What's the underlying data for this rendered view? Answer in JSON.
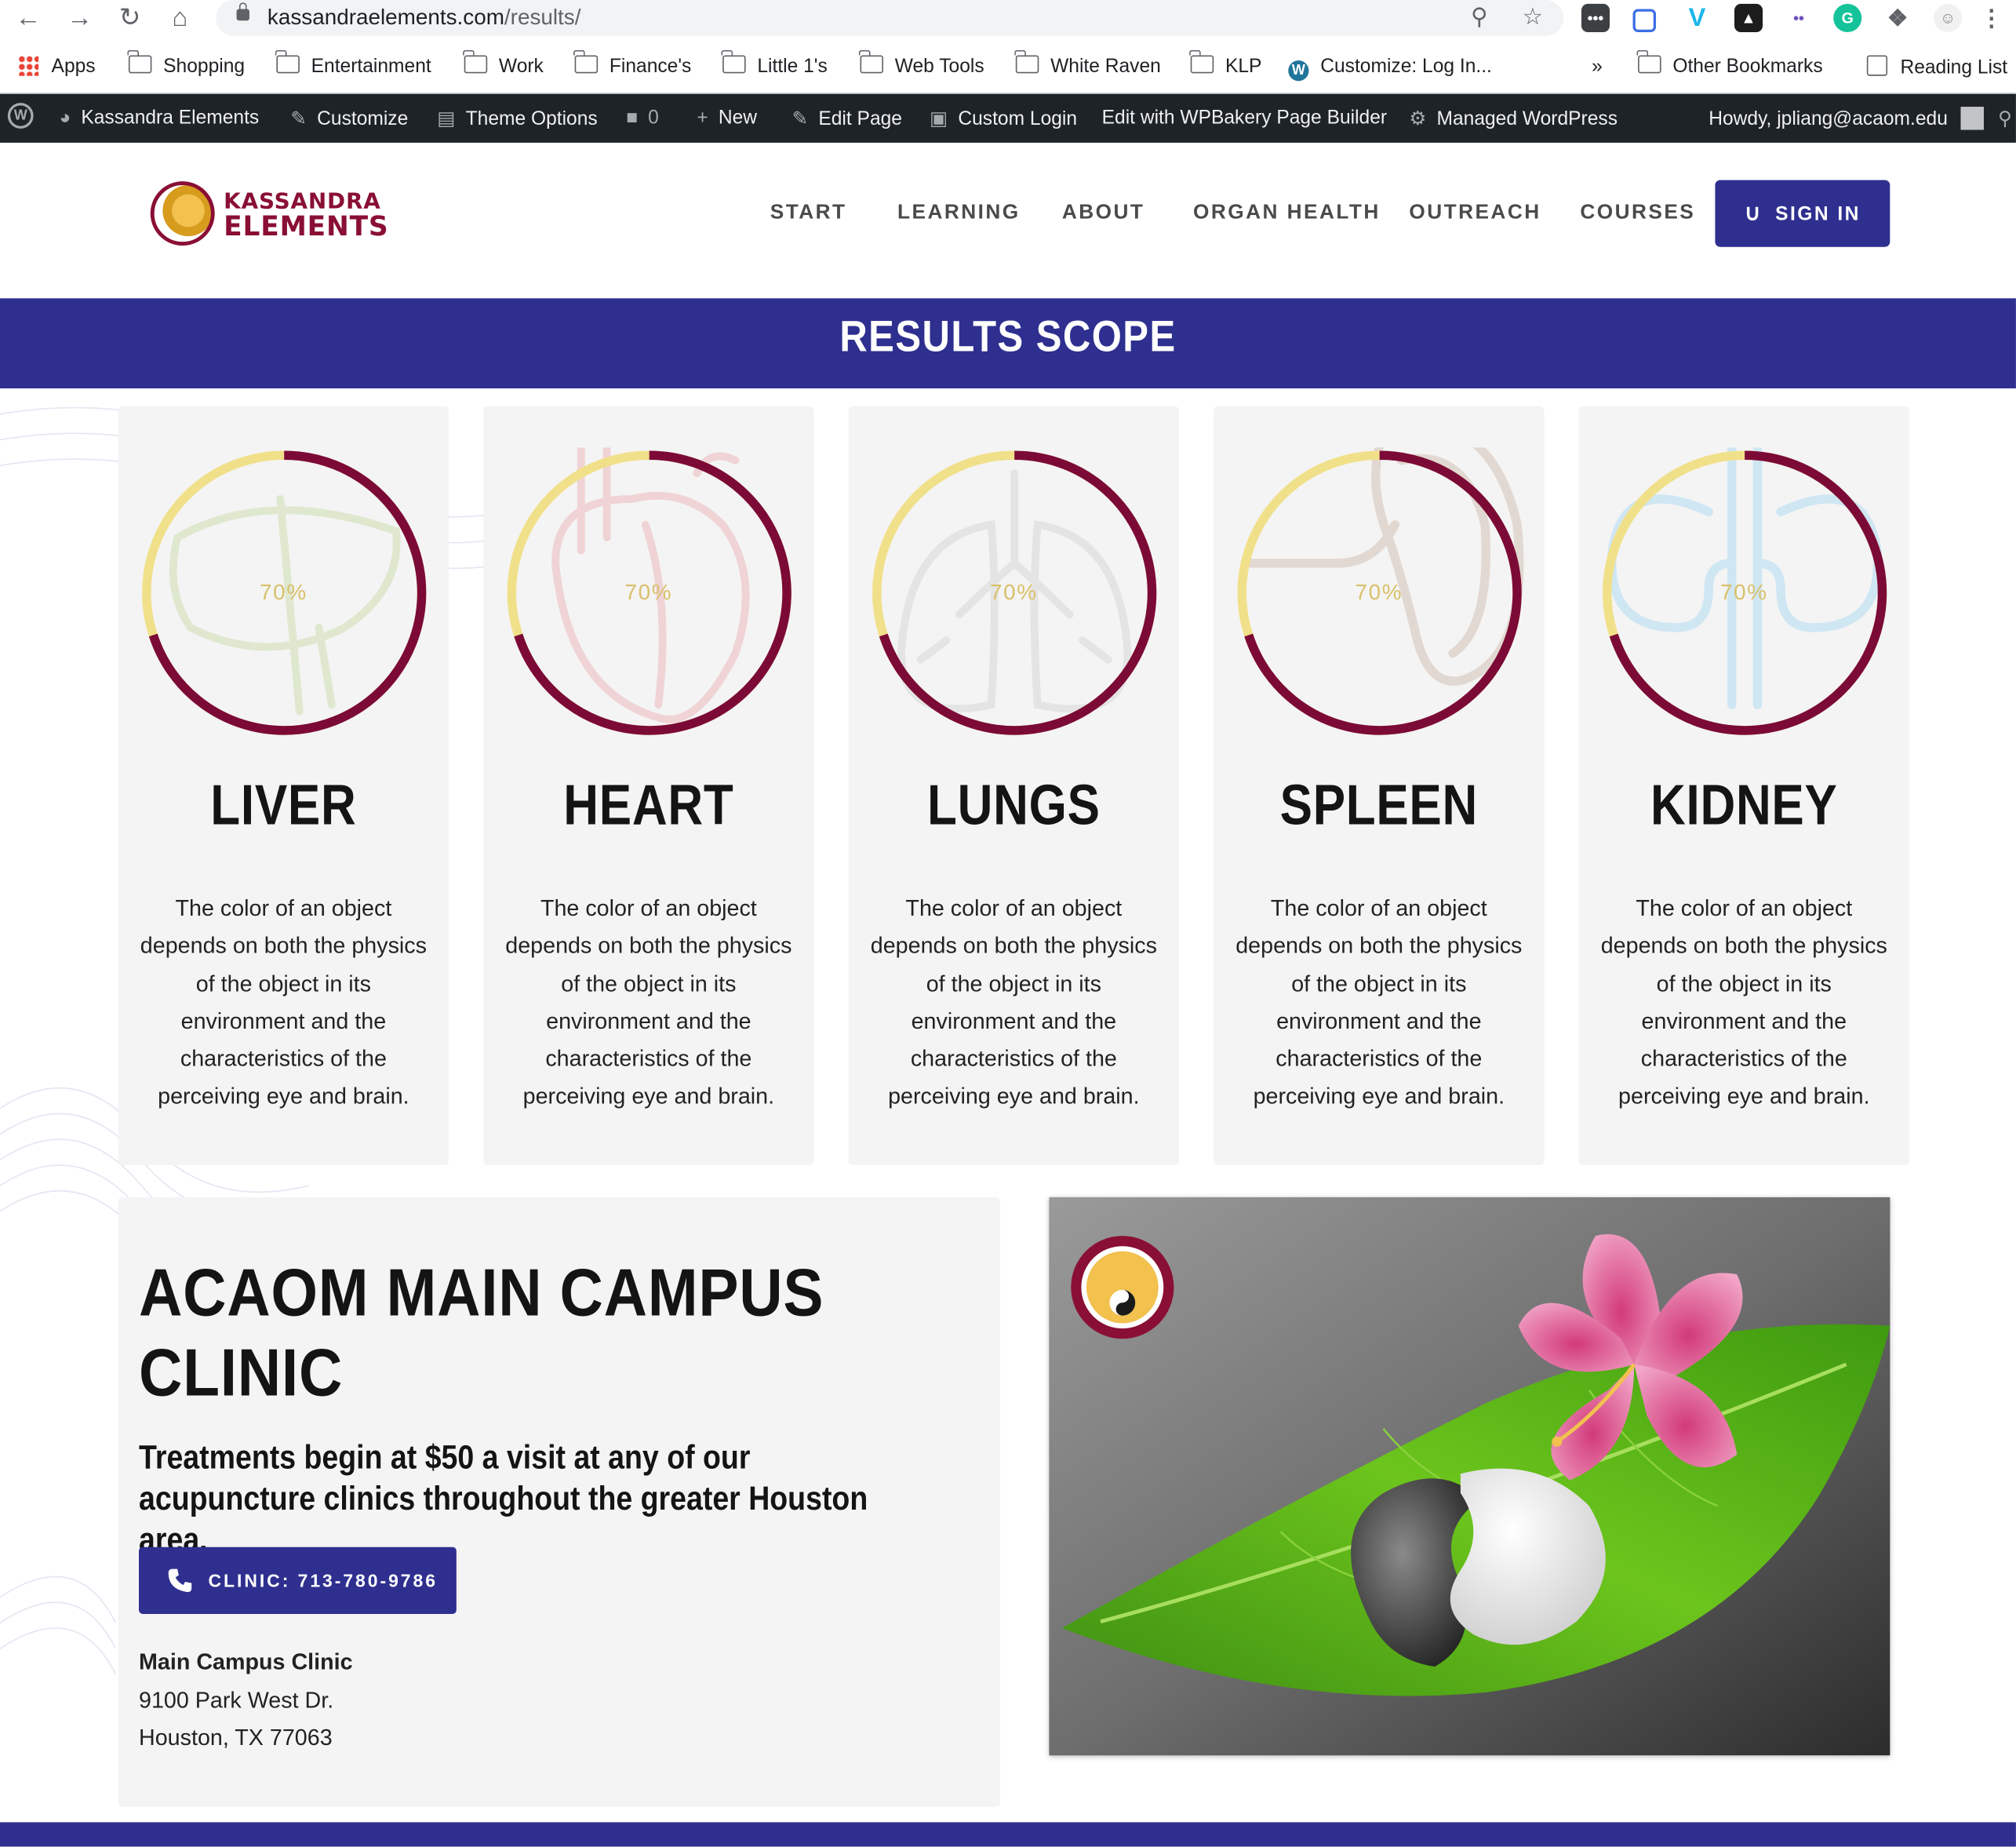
{
  "browser": {
    "url_domain": "kassandraelements.com",
    "url_path": "/results/",
    "bookmarks": [
      "Apps",
      "Shopping",
      "Entertainment",
      "Work",
      "Finance's",
      "Little 1's",
      "Web Tools",
      "White Raven",
      "KLP",
      "Customize: Log In...",
      "»",
      "Other Bookmarks",
      "Reading List"
    ]
  },
  "adminbar": {
    "site_name": "Kassandra Elements",
    "customize": "Customize",
    "theme_options": "Theme Options",
    "comments_count": "0",
    "new": "New",
    "edit_page": "Edit Page",
    "custom_login": "Custom Login",
    "wpbakery": "Edit with WPBakery Page Builder",
    "managed_wp": "Managed WordPress",
    "howdy": "Howdy, jpliang@acaom.edu"
  },
  "header": {
    "logo_line1": "KASSANDRA",
    "logo_line2": "ELEMENTS",
    "nav": [
      "START",
      "LEARNING",
      "ABOUT",
      "ORGAN HEALTH",
      "OUTREACH",
      "COURSES"
    ],
    "signin": "SIGN IN"
  },
  "band_title": "RESULTS SCOPE",
  "cards": [
    {
      "title": "LIVER",
      "percent_label": "70%",
      "progress": 0.7,
      "organ_icon": "liver-icon",
      "icon_color": "#dfe8cf",
      "body": "The color of an object depends on both the physics of the object in its environment and the characteristics of the perceiving eye and brain."
    },
    {
      "title": "HEART",
      "percent_label": "70%",
      "progress": 0.7,
      "organ_icon": "heart-organ-icon",
      "icon_color": "#f0d3d5",
      "body": "The color of an object depends on both the physics of the object in its environment and the characteristics of the perceiving eye and brain."
    },
    {
      "title": "LUNGS",
      "percent_label": "70%",
      "progress": 0.7,
      "organ_icon": "lungs-icon",
      "icon_color": "#e4e4e4",
      "body": "The color of an object depends on both the physics of the object in its environment and the characteristics of the perceiving eye and brain."
    },
    {
      "title": "SPLEEN",
      "percent_label": "70%",
      "progress": 0.7,
      "organ_icon": "spleen-icon",
      "icon_color": "#e2d8d2",
      "body": "The color of an object depends on both the physics of the object in its environment and the characteristics of the perceiving eye and brain."
    },
    {
      "title": "KIDNEY",
      "percent_label": "70%",
      "progress": 0.7,
      "organ_icon": "kidney-icon",
      "icon_color": "#cfe6f3",
      "body": "The color of an object depends on both the physics of the object in its environment and the characteristics of the perceiving eye and brain."
    }
  ],
  "ring_colors": {
    "progress": "#7c0a36",
    "track": "#f1e08a"
  },
  "clinic": {
    "title": "ACAOM MAIN CAMPUS CLINIC",
    "subtitle": "Treatments begin at $50 a visit at any of our acupuncture clinics throughout the greater Houston area.",
    "phone_button": "CLINIC: 713-780-9786",
    "address_name": "Main Campus Clinic",
    "address_line1": "9100 Park West Dr.",
    "address_line2": "Houston, TX 77063"
  },
  "colors": {
    "brand_navy": "#2e2f8f",
    "brand_maroon": "#8a0f34",
    "card_bg": "#f4f4f4"
  }
}
